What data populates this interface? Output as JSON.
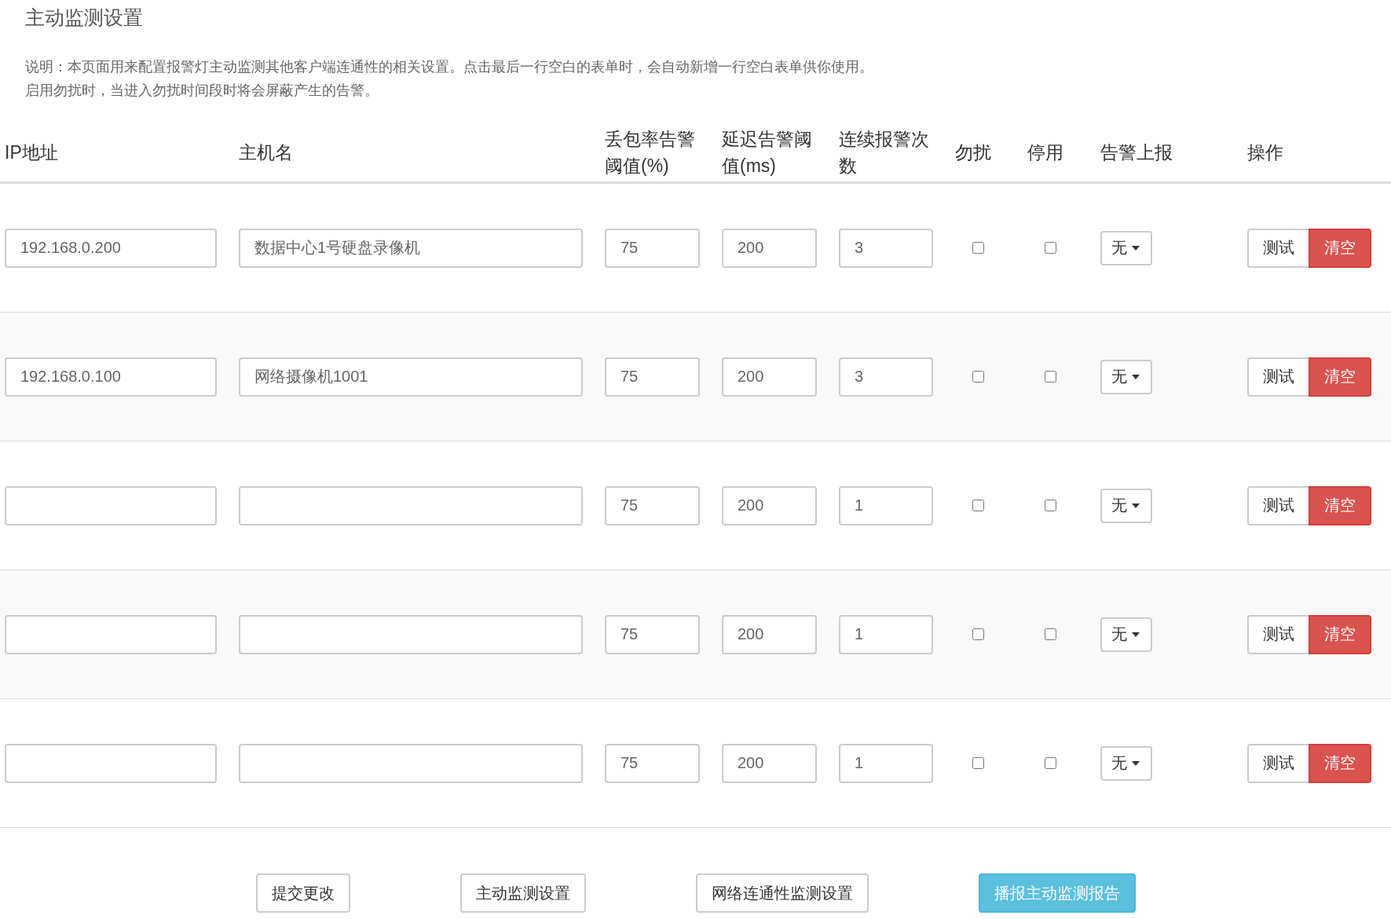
{
  "title": "主动监测设置",
  "description": [
    "说明：本页面用来配置报警灯主动监测其他客户端连通性的相关设置。点击最后一行空白的表单时，会自动新增一行空白表单供你使用。",
    "启用勿扰时，当进入勿扰时间段时将会屏蔽产生的告警。"
  ],
  "table": {
    "columns": [
      "IP地址",
      "主机名",
      "丢包率告警阈值(%)",
      "延迟告警阈值(ms)",
      "连续报警次数",
      "勿扰",
      "停用",
      "告警上报",
      "操作"
    ],
    "rows": [
      {
        "ip": "192.168.0.200",
        "hostname": "数据中心1号硬盘录像机",
        "loss": "75",
        "delay": "200",
        "count": "3",
        "dnd": false,
        "disabled": false,
        "report": "无",
        "test": "测试",
        "clear": "清空"
      },
      {
        "ip": "192.168.0.100",
        "hostname": "网络摄像机1001",
        "loss": "75",
        "delay": "200",
        "count": "3",
        "dnd": false,
        "disabled": false,
        "report": "无",
        "test": "测试",
        "clear": "清空"
      },
      {
        "loss": "75",
        "delay": "200",
        "count": "1",
        "dnd": false,
        "disabled": false,
        "report": "无",
        "test": "测试",
        "clear": "清空"
      },
      {
        "loss": "75",
        "delay": "200",
        "count": "1",
        "dnd": false,
        "disabled": false,
        "report": "无",
        "test": "测试",
        "clear": "清空"
      },
      {
        "loss": "75",
        "delay": "200",
        "count": "1",
        "dnd": false,
        "disabled": false,
        "report": "无",
        "test": "测试",
        "clear": "清空"
      }
    ]
  },
  "actions": [
    {
      "label": "提交更改",
      "kind": "default"
    },
    {
      "label": "主动监测设置",
      "kind": "default"
    },
    {
      "label": "网络连通性监测设置",
      "kind": "default"
    },
    {
      "label": "播报主动监测报告",
      "kind": "primary"
    }
  ]
}
